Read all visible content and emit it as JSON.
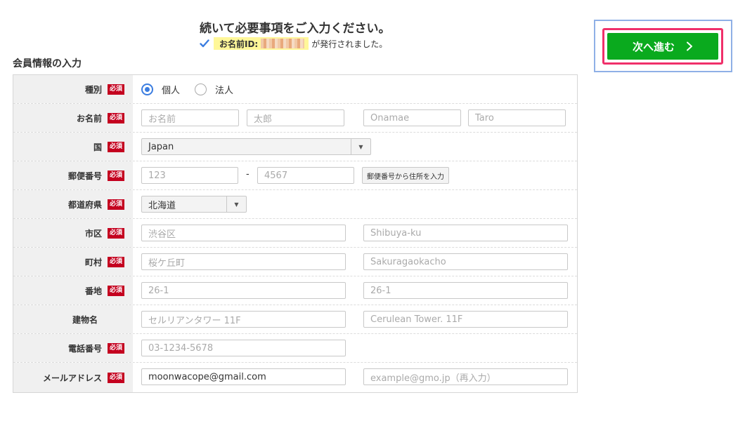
{
  "header": {
    "heading": "続いて必要事項をご入力ください。",
    "id_label": "お名前ID:",
    "id_suffix": "が発行されました。"
  },
  "section_title": "会員情報の入力",
  "required_badge": "必須",
  "next_button": {
    "label": "次へ進む",
    "icon": "chevron-right-icon"
  },
  "form": {
    "type": {
      "label": "種別",
      "options": [
        "個人",
        "法人"
      ],
      "selected": "個人"
    },
    "name": {
      "label": "お名前",
      "placeholders": [
        "お名前",
        "太郎",
        "Onamae",
        "Taro"
      ]
    },
    "country": {
      "label": "国",
      "value": "Japan"
    },
    "postal": {
      "label": "郵便番号",
      "placeholder1": "123",
      "separator": "-",
      "placeholder2": "4567",
      "lookup_button": "郵便番号から住所を入力"
    },
    "prefecture": {
      "label": "都道府県",
      "value": "北海道"
    },
    "city": {
      "label": "市区",
      "placeholders": [
        "渋谷区",
        "Shibuya-ku"
      ]
    },
    "town": {
      "label": "町村",
      "placeholders": [
        "桜ケ丘町",
        "Sakuragaokacho"
      ]
    },
    "street": {
      "label": "番地",
      "placeholders": [
        "26-1",
        "26-1"
      ]
    },
    "building": {
      "label": "建物名",
      "placeholders": [
        "セルリアンタワー 11F",
        "Cerulean Tower. 11F"
      ]
    },
    "phone": {
      "label": "電話番号",
      "placeholder": "03-1234-5678"
    },
    "email": {
      "label": "メールアドレス",
      "value": "moonwacope@gmail.com",
      "confirm_placeholder": "example@gmo.jp（再入力）"
    }
  },
  "colors": {
    "required_badge": "#c4001f",
    "next_button": "#0aaa1e",
    "next_button_highlight": "#f0306a",
    "radio_accent": "#3b7de0",
    "id_highlight": "#fff799"
  }
}
